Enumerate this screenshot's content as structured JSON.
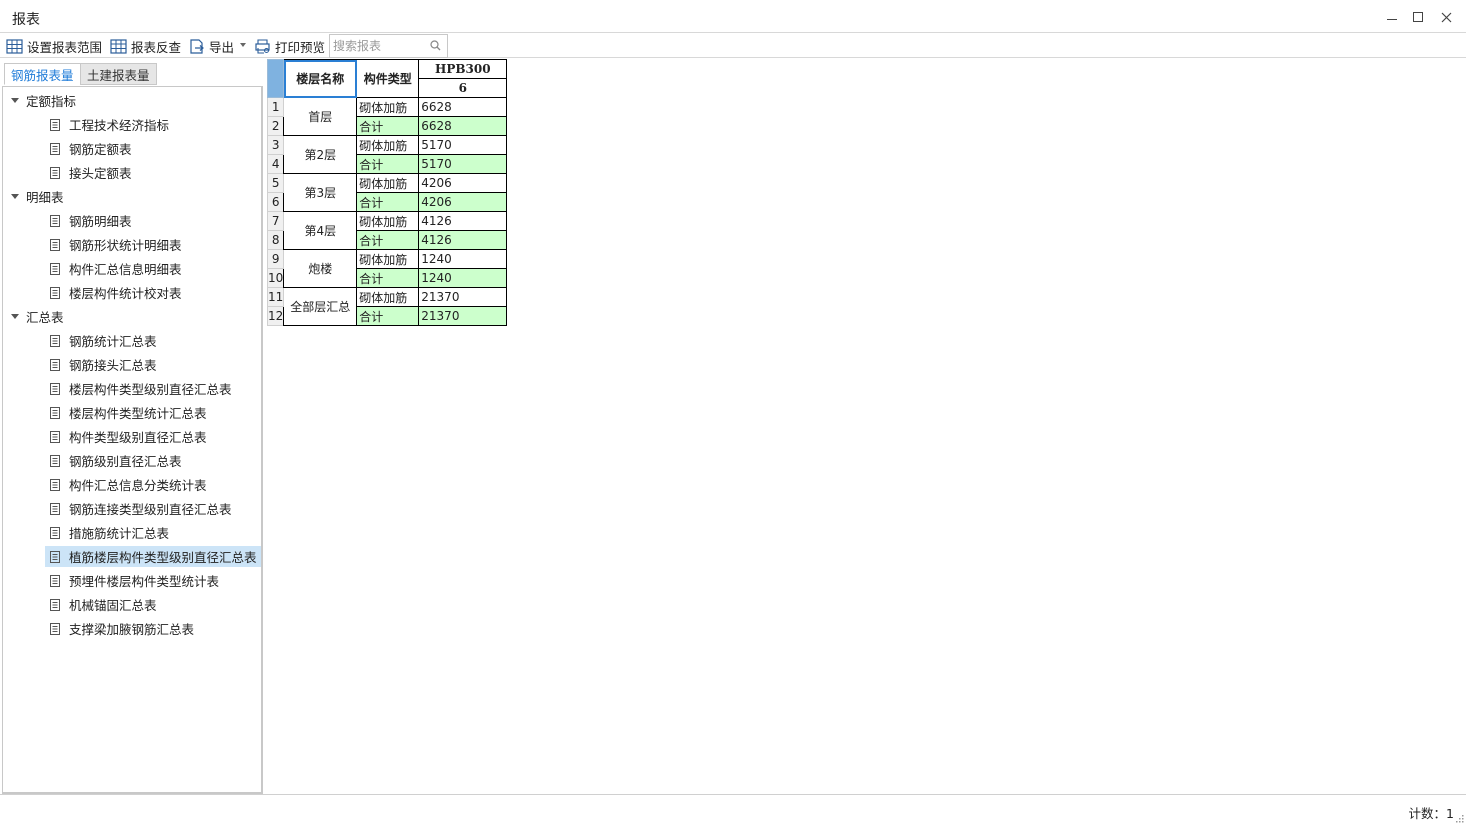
{
  "window": {
    "title": "报表"
  },
  "toolbar": {
    "set_range_label": "设置报表范围",
    "reverse_label": "报表反查",
    "export_label": "导出",
    "print_preview_label": "打印预览",
    "search_placeholder": "搜索报表"
  },
  "tabs": [
    {
      "label": "钢筋报表量",
      "active": true
    },
    {
      "label": "土建报表量",
      "active": false
    }
  ],
  "tree": {
    "groups": [
      {
        "label": "定额指标",
        "items": [
          "工程技术经济指标",
          "钢筋定额表",
          "接头定额表"
        ]
      },
      {
        "label": "明细表",
        "items": [
          "钢筋明细表",
          "钢筋形状统计明细表",
          "构件汇总信息明细表",
          "楼层构件统计校对表"
        ]
      },
      {
        "label": "汇总表",
        "items": [
          "钢筋统计汇总表",
          "钢筋接头汇总表",
          "楼层构件类型级别直径汇总表",
          "楼层构件类型统计汇总表",
          "构件类型级别直径汇总表",
          "钢筋级别直径汇总表",
          "构件汇总信息分类统计表",
          "钢筋连接类型级别直径汇总表",
          "措施筋统计汇总表",
          "植筋楼层构件类型级别直径汇总表",
          "预埋件楼层构件类型统计表",
          "机械锚固汇总表",
          "支撑梁加腋钢筋汇总表"
        ]
      }
    ],
    "selected_item": "植筋楼层构件类型级别直径汇总表"
  },
  "report": {
    "header": {
      "floor_name": "楼层名称",
      "component_type": "构件类型",
      "grade": "HPB300",
      "diameter": "6"
    },
    "rows": [
      {
        "num": "1",
        "floor": "首层",
        "type": "砌体加筋",
        "value": "6628"
      },
      {
        "num": "2",
        "floor": "",
        "type": "合计",
        "value": "6628"
      },
      {
        "num": "3",
        "floor": "第2层",
        "type": "砌体加筋",
        "value": "5170"
      },
      {
        "num": "4",
        "floor": "",
        "type": "合计",
        "value": "5170"
      },
      {
        "num": "5",
        "floor": "第3层",
        "type": "砌体加筋",
        "value": "4206"
      },
      {
        "num": "6",
        "floor": "",
        "type": "合计",
        "value": "4206"
      },
      {
        "num": "7",
        "floor": "第4层",
        "type": "砌体加筋",
        "value": "4126"
      },
      {
        "num": "8",
        "floor": "",
        "type": "合计",
        "value": "4126"
      },
      {
        "num": "9",
        "floor": "炮楼",
        "type": "砌体加筋",
        "value": "1240"
      },
      {
        "num": "10",
        "floor": "",
        "type": "合计",
        "value": "1240"
      },
      {
        "num": "11",
        "floor": "全部层汇总",
        "type": "砌体加筋",
        "value": "21370"
      },
      {
        "num": "12",
        "floor": "",
        "type": "合计",
        "value": "21370"
      }
    ],
    "subtotal_color": "#ccffcc"
  },
  "status": {
    "count_text": "计数：1"
  },
  "colors": {
    "accent": "#1e7bd8",
    "selection": "#cce4f7",
    "header_corner": "#7fb2e0"
  }
}
